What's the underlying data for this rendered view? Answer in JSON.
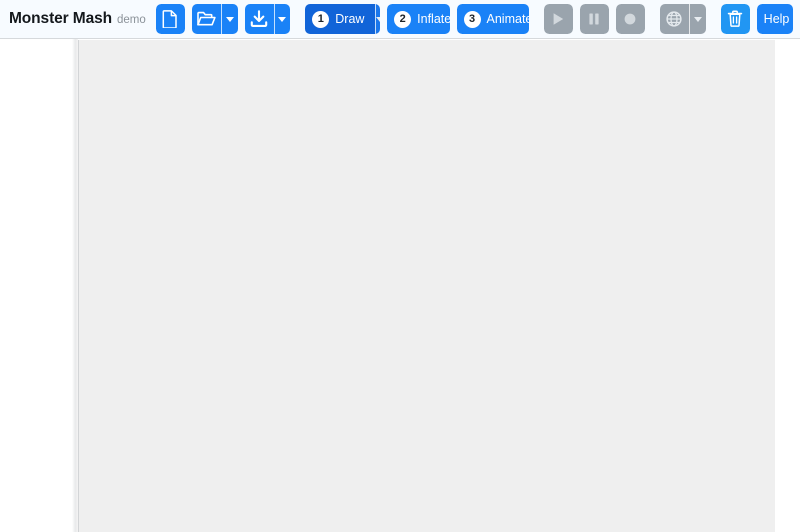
{
  "app": {
    "title": "Monster Mash",
    "subtitle": "demo"
  },
  "toolbar": {
    "file_group": {
      "new_label": "",
      "new_icon": "document-icon",
      "open_icon": "folder-open-icon",
      "open_caret_icon": "chevron-down-icon"
    },
    "save_group": {
      "save_icon": "download-icon",
      "save_caret_icon": "chevron-down-icon"
    },
    "stages": [
      {
        "number": "1",
        "label": "Draw",
        "state": "active",
        "has_caret": true
      },
      {
        "number": "2",
        "label": "Inflate",
        "state": "default",
        "has_caret": false
      },
      {
        "number": "3",
        "label": "Animate",
        "state": "default",
        "has_caret": false
      }
    ],
    "playback": [
      {
        "name": "play-button",
        "icon": "play-icon",
        "state": "disabled"
      },
      {
        "name": "pause-button",
        "icon": "pause-icon",
        "state": "disabled"
      },
      {
        "name": "record-button",
        "icon": "record-icon",
        "state": "disabled"
      }
    ],
    "export_group": {
      "globe_icon": "globe-icon",
      "globe_caret_icon": "chevron-down-icon"
    },
    "delete": {
      "icon": "trash-icon"
    },
    "help": {
      "label": "Help"
    }
  },
  "colors": {
    "accent": "#1a82f7",
    "accent_active": "#1164d8",
    "danger": "#2196f3",
    "disabled": "#9aa4ad",
    "canvas": "#efefef",
    "toolbar_bg": "#f7fbff"
  },
  "canvas": {
    "content": ""
  }
}
